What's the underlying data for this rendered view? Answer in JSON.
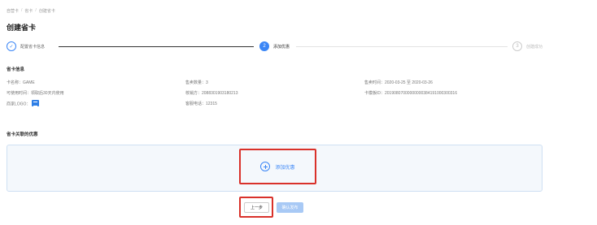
{
  "breadcrumb": [
    "自营卡",
    "省卡",
    "创建省卡"
  ],
  "page_title": "创建省卡",
  "steps": [
    {
      "index": "✓",
      "label": "配置省卡信息",
      "status": "done"
    },
    {
      "index": "2",
      "label": "添加优惠",
      "status": "active"
    },
    {
      "index": "3",
      "label": "创建成功",
      "status": "pending"
    }
  ],
  "card_info": {
    "title": "省卡信息",
    "card_name": "卡名称：GAME",
    "sale_qty": "售卖数量：3",
    "sale_time": "售卖时间：2020-03-25 至 2020-03-26",
    "valid_time": "可使用时间：领取后30天内使用",
    "merchant": "核销方：2088301903180213",
    "card_template_id": "卡模板ID：20190807000000000384191000300316",
    "logo_label": "商家LOGO：",
    "service_phone": "客服电话：12315"
  },
  "offers": {
    "title": "省卡关联的优惠",
    "add_label": "添加优惠"
  },
  "actions": {
    "prev": "上一步",
    "confirm": "确认发布"
  },
  "colors": {
    "primary": "#3b86f6",
    "highlight": "#d9312a",
    "panel": "#f4f8fc"
  }
}
